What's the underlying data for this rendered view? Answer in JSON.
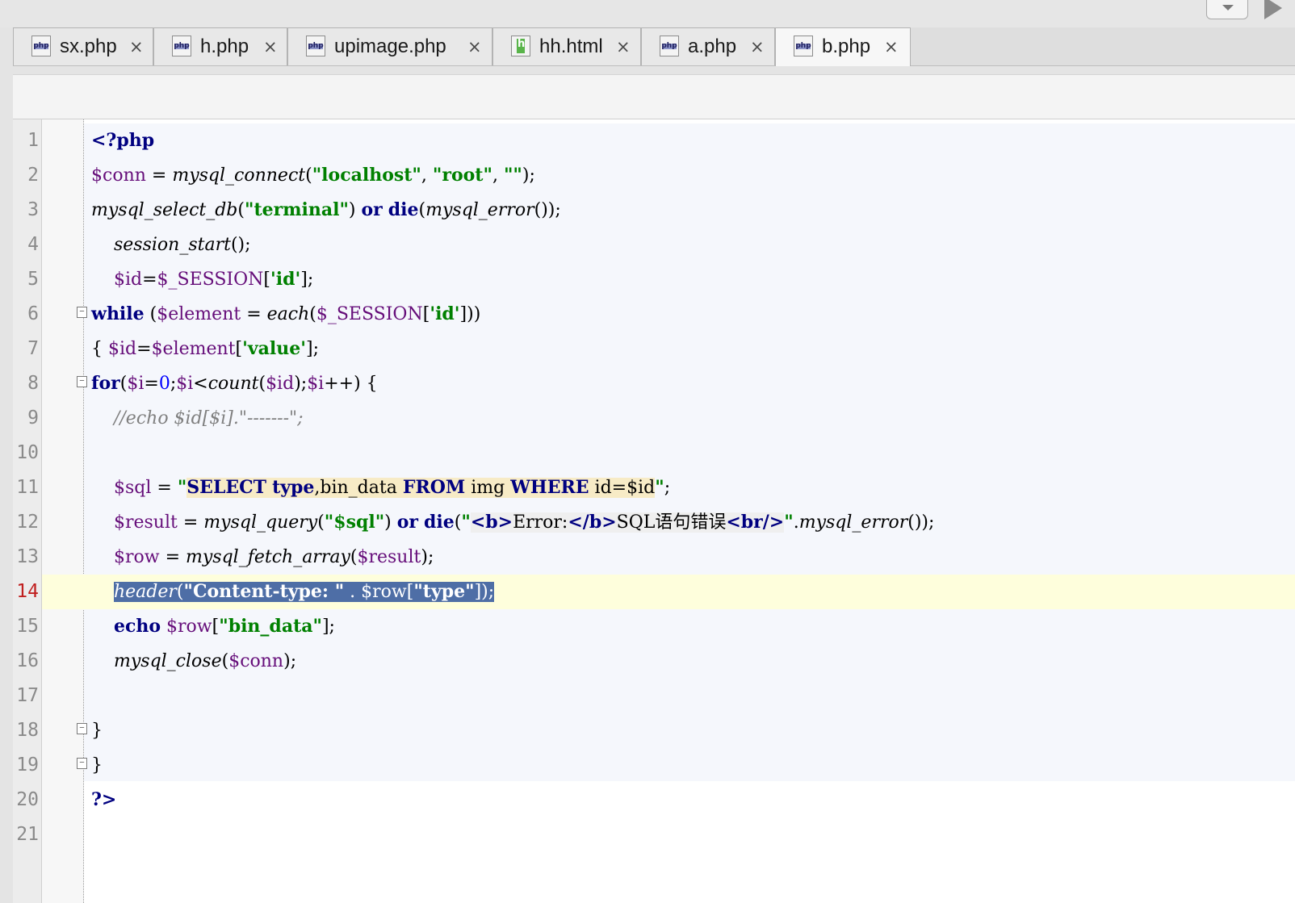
{
  "tabs": [
    {
      "label": "sx.php",
      "type": "php",
      "active": false
    },
    {
      "label": "h.php",
      "type": "php",
      "active": false
    },
    {
      "label": "upimage.php",
      "type": "php",
      "active": false
    },
    {
      "label": "hh.html",
      "type": "html",
      "active": false
    },
    {
      "label": "a.php",
      "type": "php",
      "active": false
    },
    {
      "label": "b.php",
      "type": "php",
      "active": true
    }
  ],
  "close_glyph": "×",
  "current_line": 14,
  "lines": [
    {
      "n": "1"
    },
    {
      "n": "2"
    },
    {
      "n": "3"
    },
    {
      "n": "4"
    },
    {
      "n": "5"
    },
    {
      "n": "6"
    },
    {
      "n": "7"
    },
    {
      "n": "8"
    },
    {
      "n": "9"
    },
    {
      "n": "10"
    },
    {
      "n": "11"
    },
    {
      "n": "12"
    },
    {
      "n": "13"
    },
    {
      "n": "14"
    },
    {
      "n": "15"
    },
    {
      "n": "16"
    },
    {
      "n": "17"
    },
    {
      "n": "18"
    },
    {
      "n": "19"
    },
    {
      "n": "20"
    },
    {
      "n": "21"
    }
  ],
  "code": {
    "l1": {
      "open": "<?php"
    },
    "l2": {
      "var": "$conn",
      "eq": " = ",
      "fn": "mysql_connect",
      "p1": "(",
      "s1": "\"localhost\"",
      "c1": ", ",
      "s2": "\"root\"",
      "c2": ", ",
      "s3": "\"\"",
      "end": ");"
    },
    "l3": {
      "fn": "mysql_select_db",
      "p1": "(",
      "s1": "\"terminal\"",
      "p2": ") ",
      "kw1": "or",
      "sp": " ",
      "kw2": "die",
      "p3": "(",
      "fn2": "mysql_error",
      "end": "());"
    },
    "l4": {
      "indent": "    ",
      "fn": "session_start",
      "end": "();"
    },
    "l5": {
      "indent": "    ",
      "var": "$id",
      "eq": "=",
      "var2": "$_SESSION",
      "p1": "[",
      "s1": "'id'",
      "end": "];"
    },
    "l6": {
      "kw": "while",
      "p1": " (",
      "var": "$element",
      "eq": " = ",
      "fn": "each",
      "p2": "(",
      "var2": "$_SESSION",
      "p3": "[",
      "s1": "'id'",
      "end": "]))"
    },
    "l7": {
      "p1": "{ ",
      "var": "$id",
      "eq": "=",
      "var2": "$element",
      "p2": "[",
      "s1": "'value'",
      "end": "];"
    },
    "l8": {
      "kw": "for",
      "p1": "(",
      "var": "$i",
      "eq": "=",
      "num": "0",
      "p2": ";",
      "var2": "$i",
      "lt": "<",
      "fn": "count",
      "p3": "(",
      "var3": "$id",
      "p4": ");",
      "var4": "$i",
      "end": "++) {"
    },
    "l9": {
      "indent": "    ",
      "comment": "//echo $id[$i].\"-------\";"
    },
    "l11": {
      "indent": "    ",
      "var": "$sql",
      "eq": " = ",
      "q1": "\"",
      "sk1": "SELECT",
      "sp1": " ",
      "sk2": "type",
      "t1": ",bin_data ",
      "sk3": "FROM",
      "t2": " img ",
      "sk4": "WHERE",
      "t3": " id=$id",
      "q2": "\"",
      "end": ";"
    },
    "l12": {
      "indent": "    ",
      "var": "$result",
      "eq": " = ",
      "fn": "mysql_query",
      "p1": "(",
      "s1": "\"$sql\"",
      "p2": ") ",
      "kw1": "or",
      "sp": " ",
      "kw2": "die",
      "p3": "(",
      "q1": "\"",
      "h1": "<b>",
      "ht1": "Error:",
      "h2": "</b>",
      "ht2": "SQL语句错误",
      "h3": "<br/>",
      "q2": "\"",
      "dot": ".",
      "fn2": "mysql_error",
      "end": "());"
    },
    "l13": {
      "indent": "    ",
      "var": "$row",
      "eq": " = ",
      "fn": "mysql_fetch_array",
      "p1": "(",
      "var2": "$result",
      "end": ");"
    },
    "l14": {
      "indent": "    ",
      "sel_fn": "header",
      "sel_p1": "(",
      "sel_s1": "\"Content-type: \"",
      "sel_dot": " . ",
      "sel_var": "$row",
      "sel_p2": "[",
      "sel_s2": "\"type\"",
      "sel_end": "]);"
    },
    "l15": {
      "indent": "    ",
      "kw": "echo",
      "sp": " ",
      "var": "$row",
      "p1": "[",
      "s1": "\"bin_data\"",
      "end": "];"
    },
    "l16": {
      "indent": "    ",
      "fn": "mysql_close",
      "p1": "(",
      "var": "$conn",
      "end": ");"
    },
    "l18": {
      "txt": "}"
    },
    "l19": {
      "txt": "}"
    },
    "l20": {
      "close": "?>"
    }
  }
}
